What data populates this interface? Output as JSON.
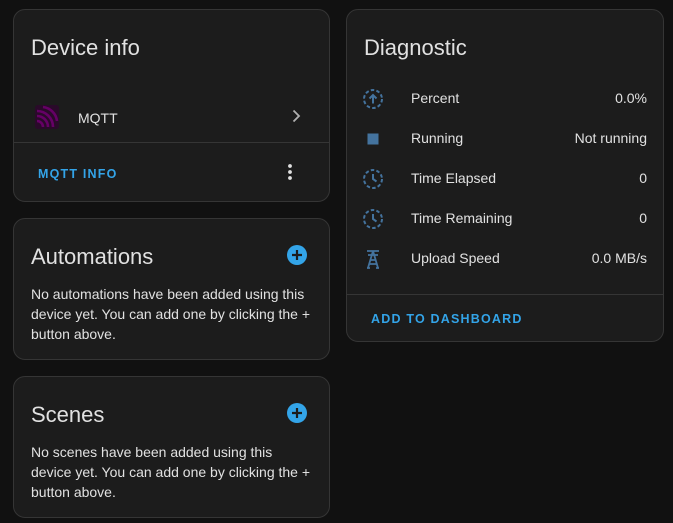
{
  "device_info": {
    "title": "Device info",
    "integration_name": "MQTT",
    "action_label": "MQTT INFO",
    "icons": {
      "integration": "mqtt-logo-icon",
      "chevron": "chevron-right-icon",
      "menu": "more-vertical-icon"
    }
  },
  "automations": {
    "title": "Automations",
    "empty_text": "No automations have been added using this device yet. You can add one by clicking the + button above.",
    "icon": "plus-circle-icon"
  },
  "scenes": {
    "title": "Scenes",
    "empty_text": "No scenes have been added using this device yet. You can add one by clicking the + button above.",
    "icon": "plus-circle-icon"
  },
  "diagnostic": {
    "title": "Diagnostic",
    "rows": [
      {
        "name": "Percent",
        "value": "0.0%",
        "icon": "progress-upload-icon"
      },
      {
        "name": "Running",
        "value": "Not running",
        "icon": "stop-icon"
      },
      {
        "name": "Time Elapsed",
        "value": "0",
        "icon": "clock-dashed-icon"
      },
      {
        "name": "Time Remaining",
        "value": "0",
        "icon": "clock-dashed-icon"
      },
      {
        "name": "Upload Speed",
        "value": "0.0 MB/s",
        "icon": "transmission-tower-icon"
      }
    ],
    "action_label": "ADD TO DASHBOARD"
  },
  "colors": {
    "accent": "#33a4e8",
    "icon_blue": "#44739e",
    "mqtt_purple": "#660066",
    "card_bg": "#1c1c1c",
    "page_bg": "#111111"
  }
}
